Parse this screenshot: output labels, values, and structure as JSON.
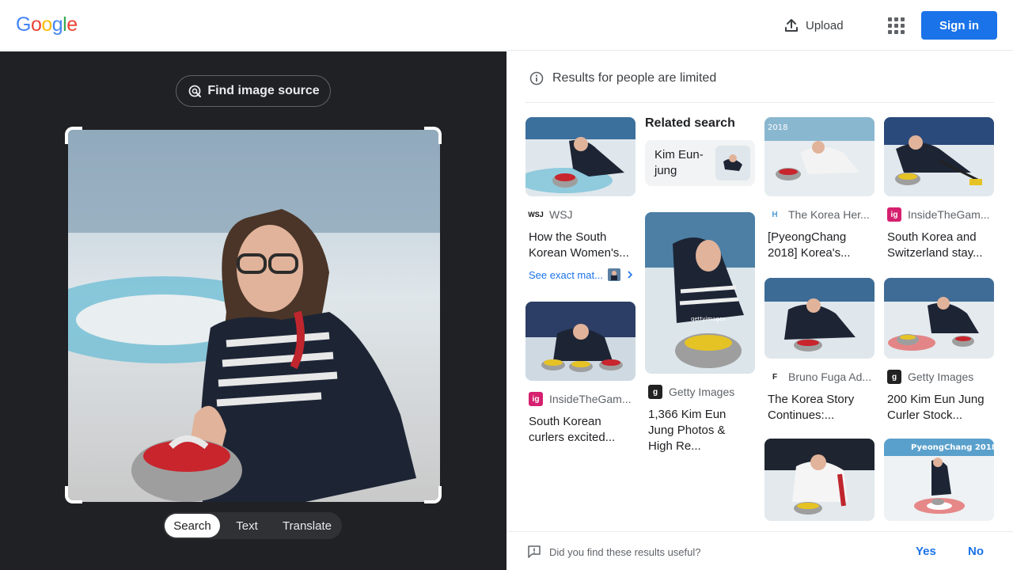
{
  "header": {
    "logo": [
      "G",
      "o",
      "o",
      "g",
      "l",
      "e"
    ],
    "logo_colors": [
      "#4285F4",
      "#EA4335",
      "#FBBC05",
      "#4285F4",
      "#34A853",
      "#EA4335"
    ],
    "upload_label": "Upload",
    "signin_label": "Sign in",
    "accent": "#1a73e8"
  },
  "left": {
    "find_source_label": "Find image source",
    "modes": [
      "Search",
      "Text",
      "Translate"
    ],
    "active_mode": "Search"
  },
  "right": {
    "notice": "Results for people are limited",
    "related_heading": "Related search",
    "related_chip": "Kim Eun-jung",
    "see_exact": "See exact mat...",
    "results": [
      {
        "source": "WSJ",
        "title": "How the South Korean Women's..."
      },
      {
        "source": "InsideTheGam...",
        "title": "South Korean curlers excited..."
      },
      {
        "source": "Getty Images",
        "title": "1,366 Kim Eun Jung Photos & High Re..."
      },
      {
        "source": "The Korea Her...",
        "title": "[PyeongChang 2018] Korea's..."
      },
      {
        "source": "Bruno Fuga Ad...",
        "title": "The Korea Story Continues:..."
      },
      {
        "source": "InsideTheGam...",
        "title": "South Korea and Switzerland stay..."
      },
      {
        "source": "Getty Images",
        "title": "200 Kim Eun Jung Curler Stock..."
      }
    ],
    "thumb_badges": {
      "korea_herald": "2018",
      "pyeongchang": "PyeongChang 2018",
      "getty_mark": "gettyimages"
    },
    "feedback_question": "Did you find these results useful?",
    "feedback_yes": "Yes",
    "feedback_no": "No"
  }
}
